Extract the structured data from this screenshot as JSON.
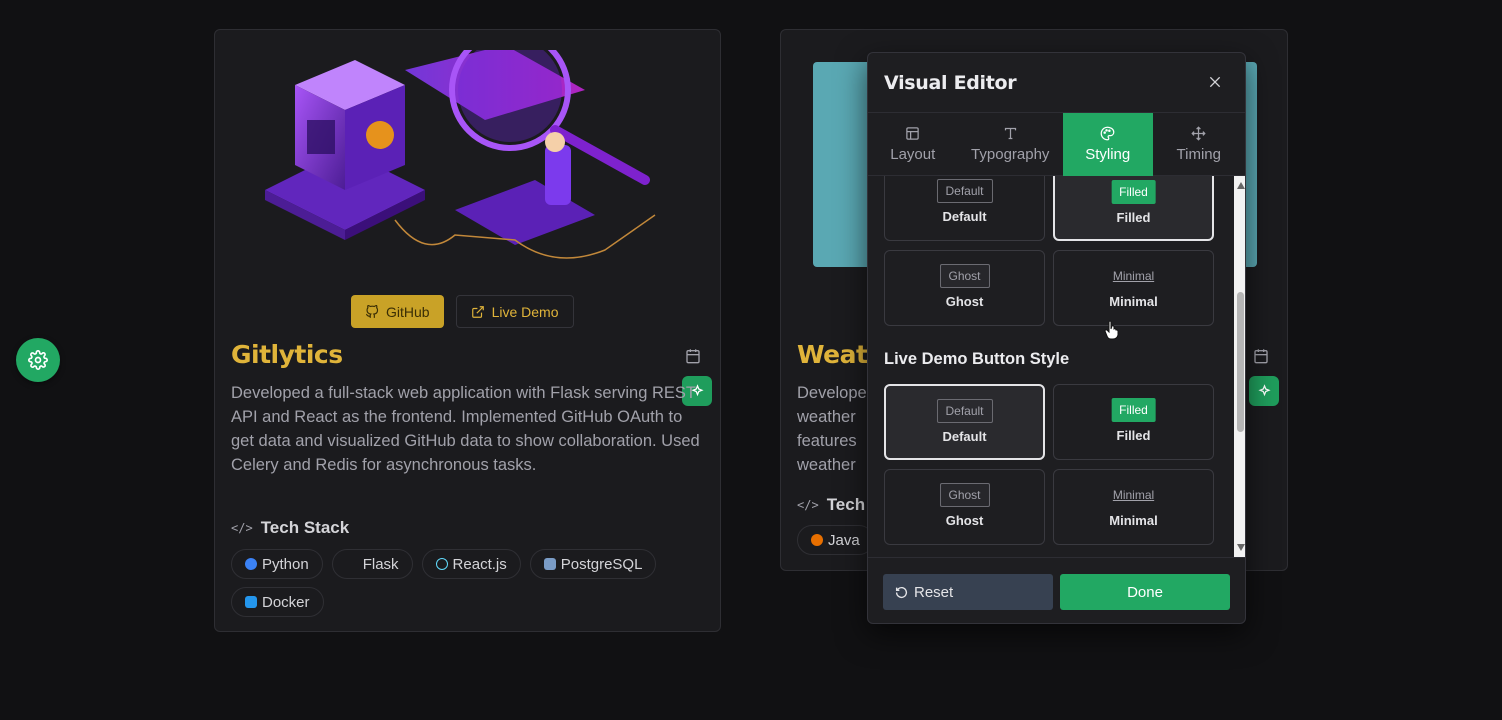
{
  "fab": {
    "icon": "gear-icon"
  },
  "cards": [
    {
      "github_label": "GitHub",
      "demo_label": "Live Demo",
      "title": "Gitlytics",
      "description": "Developed a full-stack web application with Flask serving REST API and React as the frontend. Implemented GitHub OAuth to get data and visualized GitHub data to show collaboration. Used Celery and Redis for asynchronous tasks.",
      "tech_heading": "Tech Stack",
      "tech": [
        "Python",
        "Flask",
        "React.js",
        "PostgreSQL",
        "Docker"
      ]
    },
    {
      "title": "Weath",
      "description_lines": [
        "Develope",
        "weather",
        "features",
        "weather"
      ],
      "tech_heading": "Tech S",
      "tech": [
        "Java"
      ]
    }
  ],
  "editor": {
    "title": "Visual Editor",
    "tabs": [
      {
        "label": "Layout",
        "icon": "layout-icon"
      },
      {
        "label": "Typography",
        "icon": "type-icon"
      },
      {
        "label": "Styling",
        "icon": "palette-icon",
        "active": true
      },
      {
        "label": "Timing",
        "icon": "move-icon"
      }
    ],
    "github_styles": {
      "options": [
        {
          "sample": "Default",
          "label": "Default"
        },
        {
          "sample": "Filled",
          "label": "Filled",
          "selected": true
        },
        {
          "sample": "Ghost",
          "label": "Ghost"
        },
        {
          "sample": "Minimal",
          "label": "Minimal"
        }
      ]
    },
    "live_demo_section": {
      "title": "Live Demo Button Style",
      "options": [
        {
          "sample": "Default",
          "label": "Default",
          "selected": true
        },
        {
          "sample": "Filled",
          "label": "Filled"
        },
        {
          "sample": "Ghost",
          "label": "Ghost"
        },
        {
          "sample": "Minimal",
          "label": "Minimal"
        }
      ]
    },
    "reset_label": "Reset",
    "done_label": "Done"
  },
  "colors": {
    "accent_green": "#22a863",
    "title_gold": "#e0b43a",
    "github_button": "#c9a227"
  }
}
